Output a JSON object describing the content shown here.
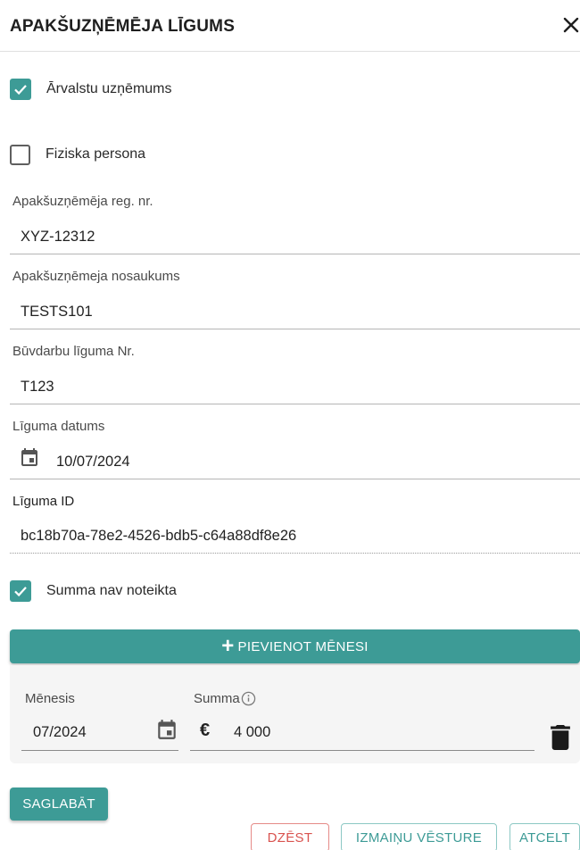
{
  "header": {
    "title": "APAKŠUZŅĒMĒJA LĪGUMS"
  },
  "checkboxes": {
    "foreign_company": {
      "label": "Ārvalstu uzņēmums",
      "checked": true
    },
    "natural_person": {
      "label": "Fiziska persona",
      "checked": false
    },
    "amount_not_defined": {
      "label": "Summa nav noteikta",
      "checked": true
    }
  },
  "fields": {
    "reg_nr": {
      "label": "Apakšuzņēmēja reg. nr.",
      "value": "XYZ-12312"
    },
    "name": {
      "label": "Apakšuzņēmeja nosaukums",
      "value": "TESTS101"
    },
    "construction_contract_nr": {
      "label": "Būvdarbu līguma Nr.",
      "value": "T123"
    },
    "contract_date": {
      "label": "Līguma datums",
      "value": "10/07/2024"
    },
    "contract_id": {
      "label": "Līguma ID",
      "value": "bc18b70a-78e2-4526-bdb5-c64a88df8e26"
    }
  },
  "months": {
    "add_button_label": "PIEVIENOT MĒNESI",
    "month_label": "Mēnesis",
    "sum_label": "Summa",
    "currency_symbol": "€",
    "rows": [
      {
        "month": "07/2024",
        "sum": "4 000"
      }
    ]
  },
  "actions": {
    "save": "SAGLABĀT",
    "delete": "DZĒST",
    "history": "IZMAIŅU VĒSTURE",
    "cancel": "ATCELT"
  },
  "colors": {
    "accent": "#3d9b96",
    "danger": "#d9534f"
  }
}
